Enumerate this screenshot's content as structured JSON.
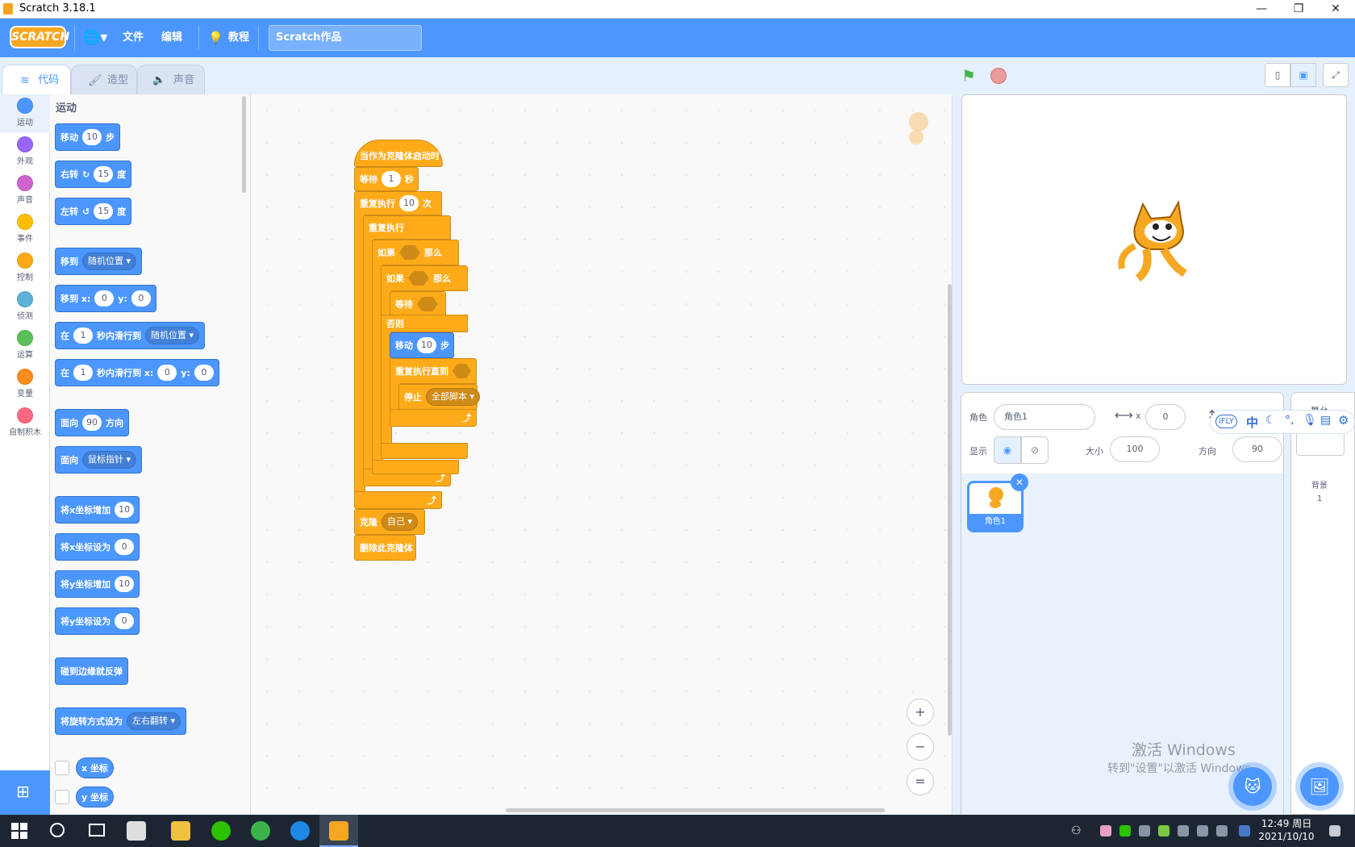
{
  "window": {
    "title": "Scratch 3.18.1",
    "minimize": "—",
    "restore": "❐",
    "close": "✕"
  },
  "menu": {
    "logo": "SCRATCH",
    "file": "文件",
    "edit": "编辑",
    "tutorial": "教程",
    "project_title": "Scratch作品"
  },
  "tabs": {
    "code": "代码",
    "costumes": "造型",
    "sounds": "声音"
  },
  "categories": [
    "运动",
    "外观",
    "声音",
    "事件",
    "控制",
    "侦测",
    "运算",
    "变量",
    "自制积木"
  ],
  "category_colors": [
    "#4c97ff",
    "#9966ff",
    "#cf63cf",
    "#ffbf00",
    "#ffab19",
    "#5cb1d6",
    "#59c059",
    "#ff8c1a",
    "#ff6680"
  ],
  "palette": {
    "heading": "运动",
    "move": {
      "a": "移动",
      "v": "10",
      "b": "步"
    },
    "turn_right": {
      "a": "右转",
      "v": "15",
      "b": "度",
      "icon": "↻"
    },
    "turn_left": {
      "a": "左转",
      "v": "15",
      "b": "度",
      "icon": "↺"
    },
    "goto": {
      "a": "移到",
      "dd": "随机位置"
    },
    "goto_xy": {
      "a": "移到 x:",
      "x": "0",
      "y_label": "y:",
      "y": "0"
    },
    "glide": {
      "a": "在",
      "v": "1",
      "b": "秒内滑行到",
      "dd": "随机位置"
    },
    "glide_xy": {
      "a": "在",
      "v": "1",
      "b": "秒内滑行到 x:",
      "x": "0",
      "y_label": "y:",
      "y": "0"
    },
    "point_dir": {
      "a": "面向",
      "v": "90",
      "b": "方向"
    },
    "point_towards": {
      "a": "面向",
      "dd": "鼠标指针"
    },
    "change_x": {
      "a": "将x坐标增加",
      "v": "10"
    },
    "set_x": {
      "a": "将x坐标设为",
      "v": "0"
    },
    "change_y": {
      "a": "将y坐标增加",
      "v": "10"
    },
    "set_y": {
      "a": "将y坐标设为",
      "v": "0"
    },
    "bounce": {
      "a": "碰到边缘就反弹"
    },
    "rotation_style": {
      "a": "将旋转方式设为",
      "dd": "左右翻转"
    },
    "x_pos": "x 坐标",
    "y_pos": "y 坐标"
  },
  "script": {
    "hat": "当作为克隆体启动时",
    "wait": {
      "a": "等待",
      "v": "1",
      "b": "秒"
    },
    "repeat": {
      "a": "重复执行",
      "v": "10",
      "b": "次"
    },
    "forever": "重复执行",
    "if1": {
      "a": "如果",
      "b": "那么"
    },
    "if2": {
      "a": "如果",
      "b": "那么"
    },
    "wait_until": "等待",
    "else": "否则",
    "move": {
      "a": "移动",
      "v": "10",
      "b": "步"
    },
    "repeat_until": "重复执行直到",
    "stop": {
      "a": "停止",
      "dd": "全部脚本"
    },
    "clone": {
      "a": "克隆",
      "dd": "自己"
    },
    "delete_clone": "删除此克隆体",
    "loop_arrow": "⤴"
  },
  "zoom": {
    "in": "+",
    "out": "−",
    "reset": "="
  },
  "sprite_info": {
    "sprite_label": "角色",
    "sprite_name": "角色1",
    "x_label": "x",
    "x": "0",
    "show_label": "显示",
    "size_label": "大小",
    "size": "100",
    "dir_label": "方向",
    "direction": "90",
    "thumb_name": "角色1"
  },
  "stage_panel": {
    "title": "舞台",
    "backdrops_label": "背景",
    "backdrops_count": "1"
  },
  "watermark": {
    "line1": "激活 Windows",
    "line2": "转到\"设置\"以激活 Windows。"
  },
  "ifly": {
    "brand": "iFLY",
    "lang": "中"
  },
  "taskbar": {
    "time": "12:49 周日",
    "date": "2021/10/10"
  }
}
